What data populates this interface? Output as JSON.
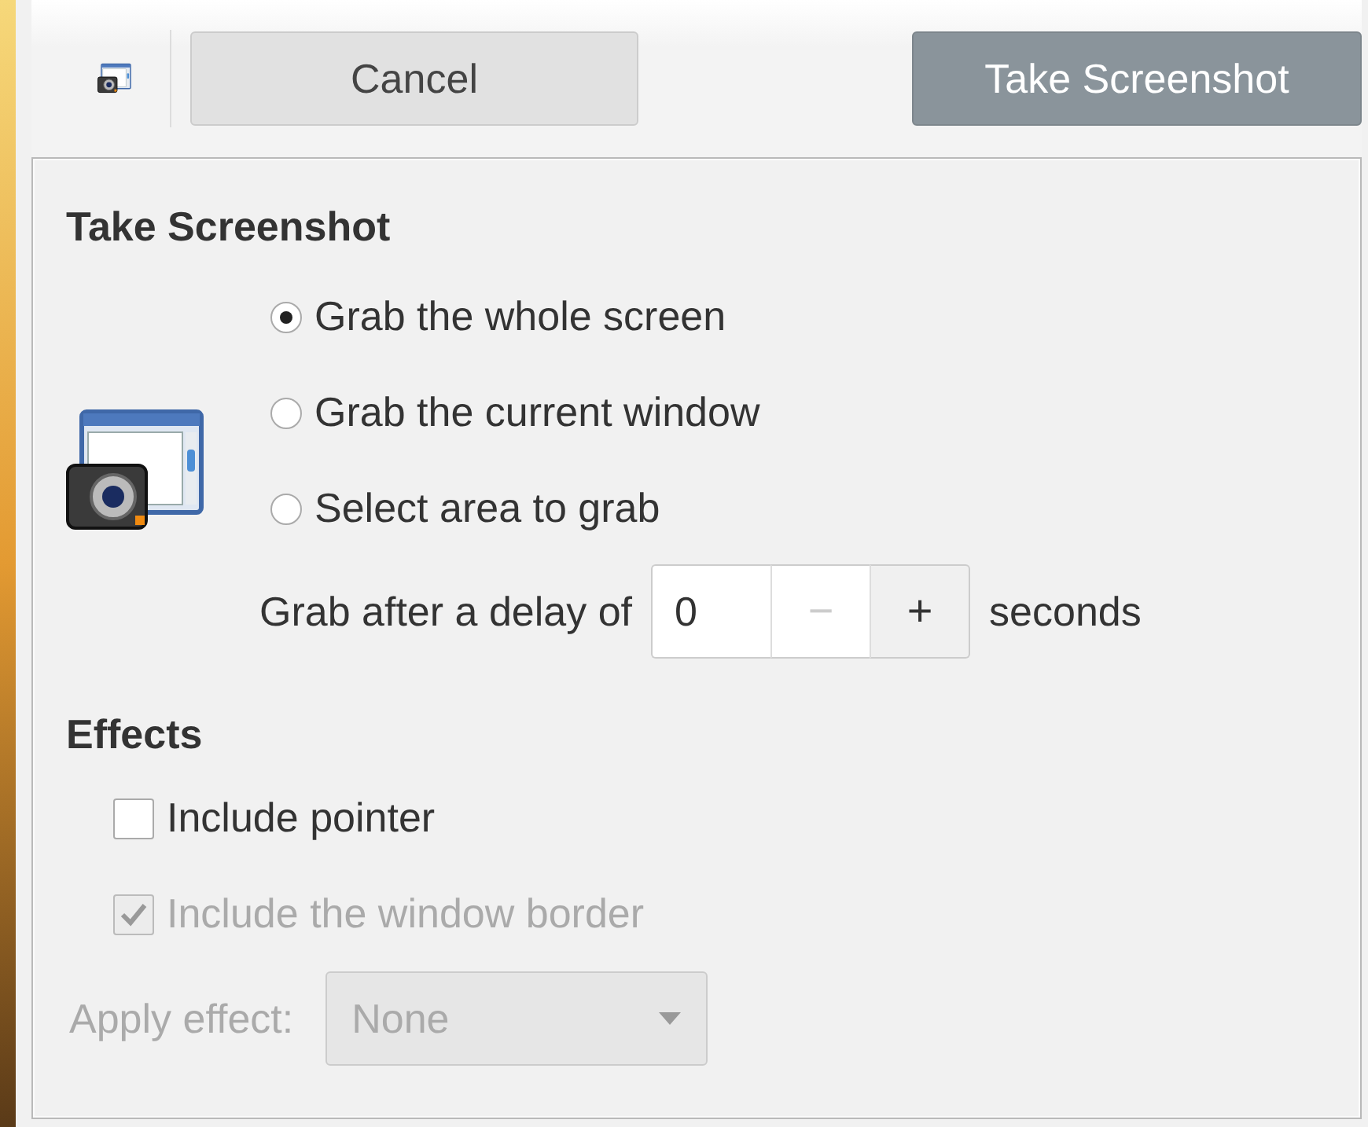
{
  "toolbar": {
    "cancel_button": "Cancel",
    "take_button": "Take Screenshot"
  },
  "take_section": {
    "heading": "Take Screenshot",
    "options": [
      {
        "label": "Grab the whole screen",
        "selected": true
      },
      {
        "label": "Grab the current window",
        "selected": false
      },
      {
        "label": "Select area to grab",
        "selected": false
      }
    ],
    "delay": {
      "label": "Grab after a delay of",
      "value": "0",
      "unit": "seconds",
      "steppers": [
        {
          "label": "−",
          "disabled": true
        },
        {
          "label": "+",
          "disabled": false
        }
      ]
    }
  },
  "effects": {
    "heading": "Effects",
    "options": [
      {
        "label": "Include pointer",
        "checked": false,
        "disabled": false
      },
      {
        "label": "Include the window border",
        "checked": true,
        "disabled": true
      }
    ],
    "apply_effect": {
      "label": "Apply effect:",
      "value": "None",
      "disabled": true
    }
  }
}
